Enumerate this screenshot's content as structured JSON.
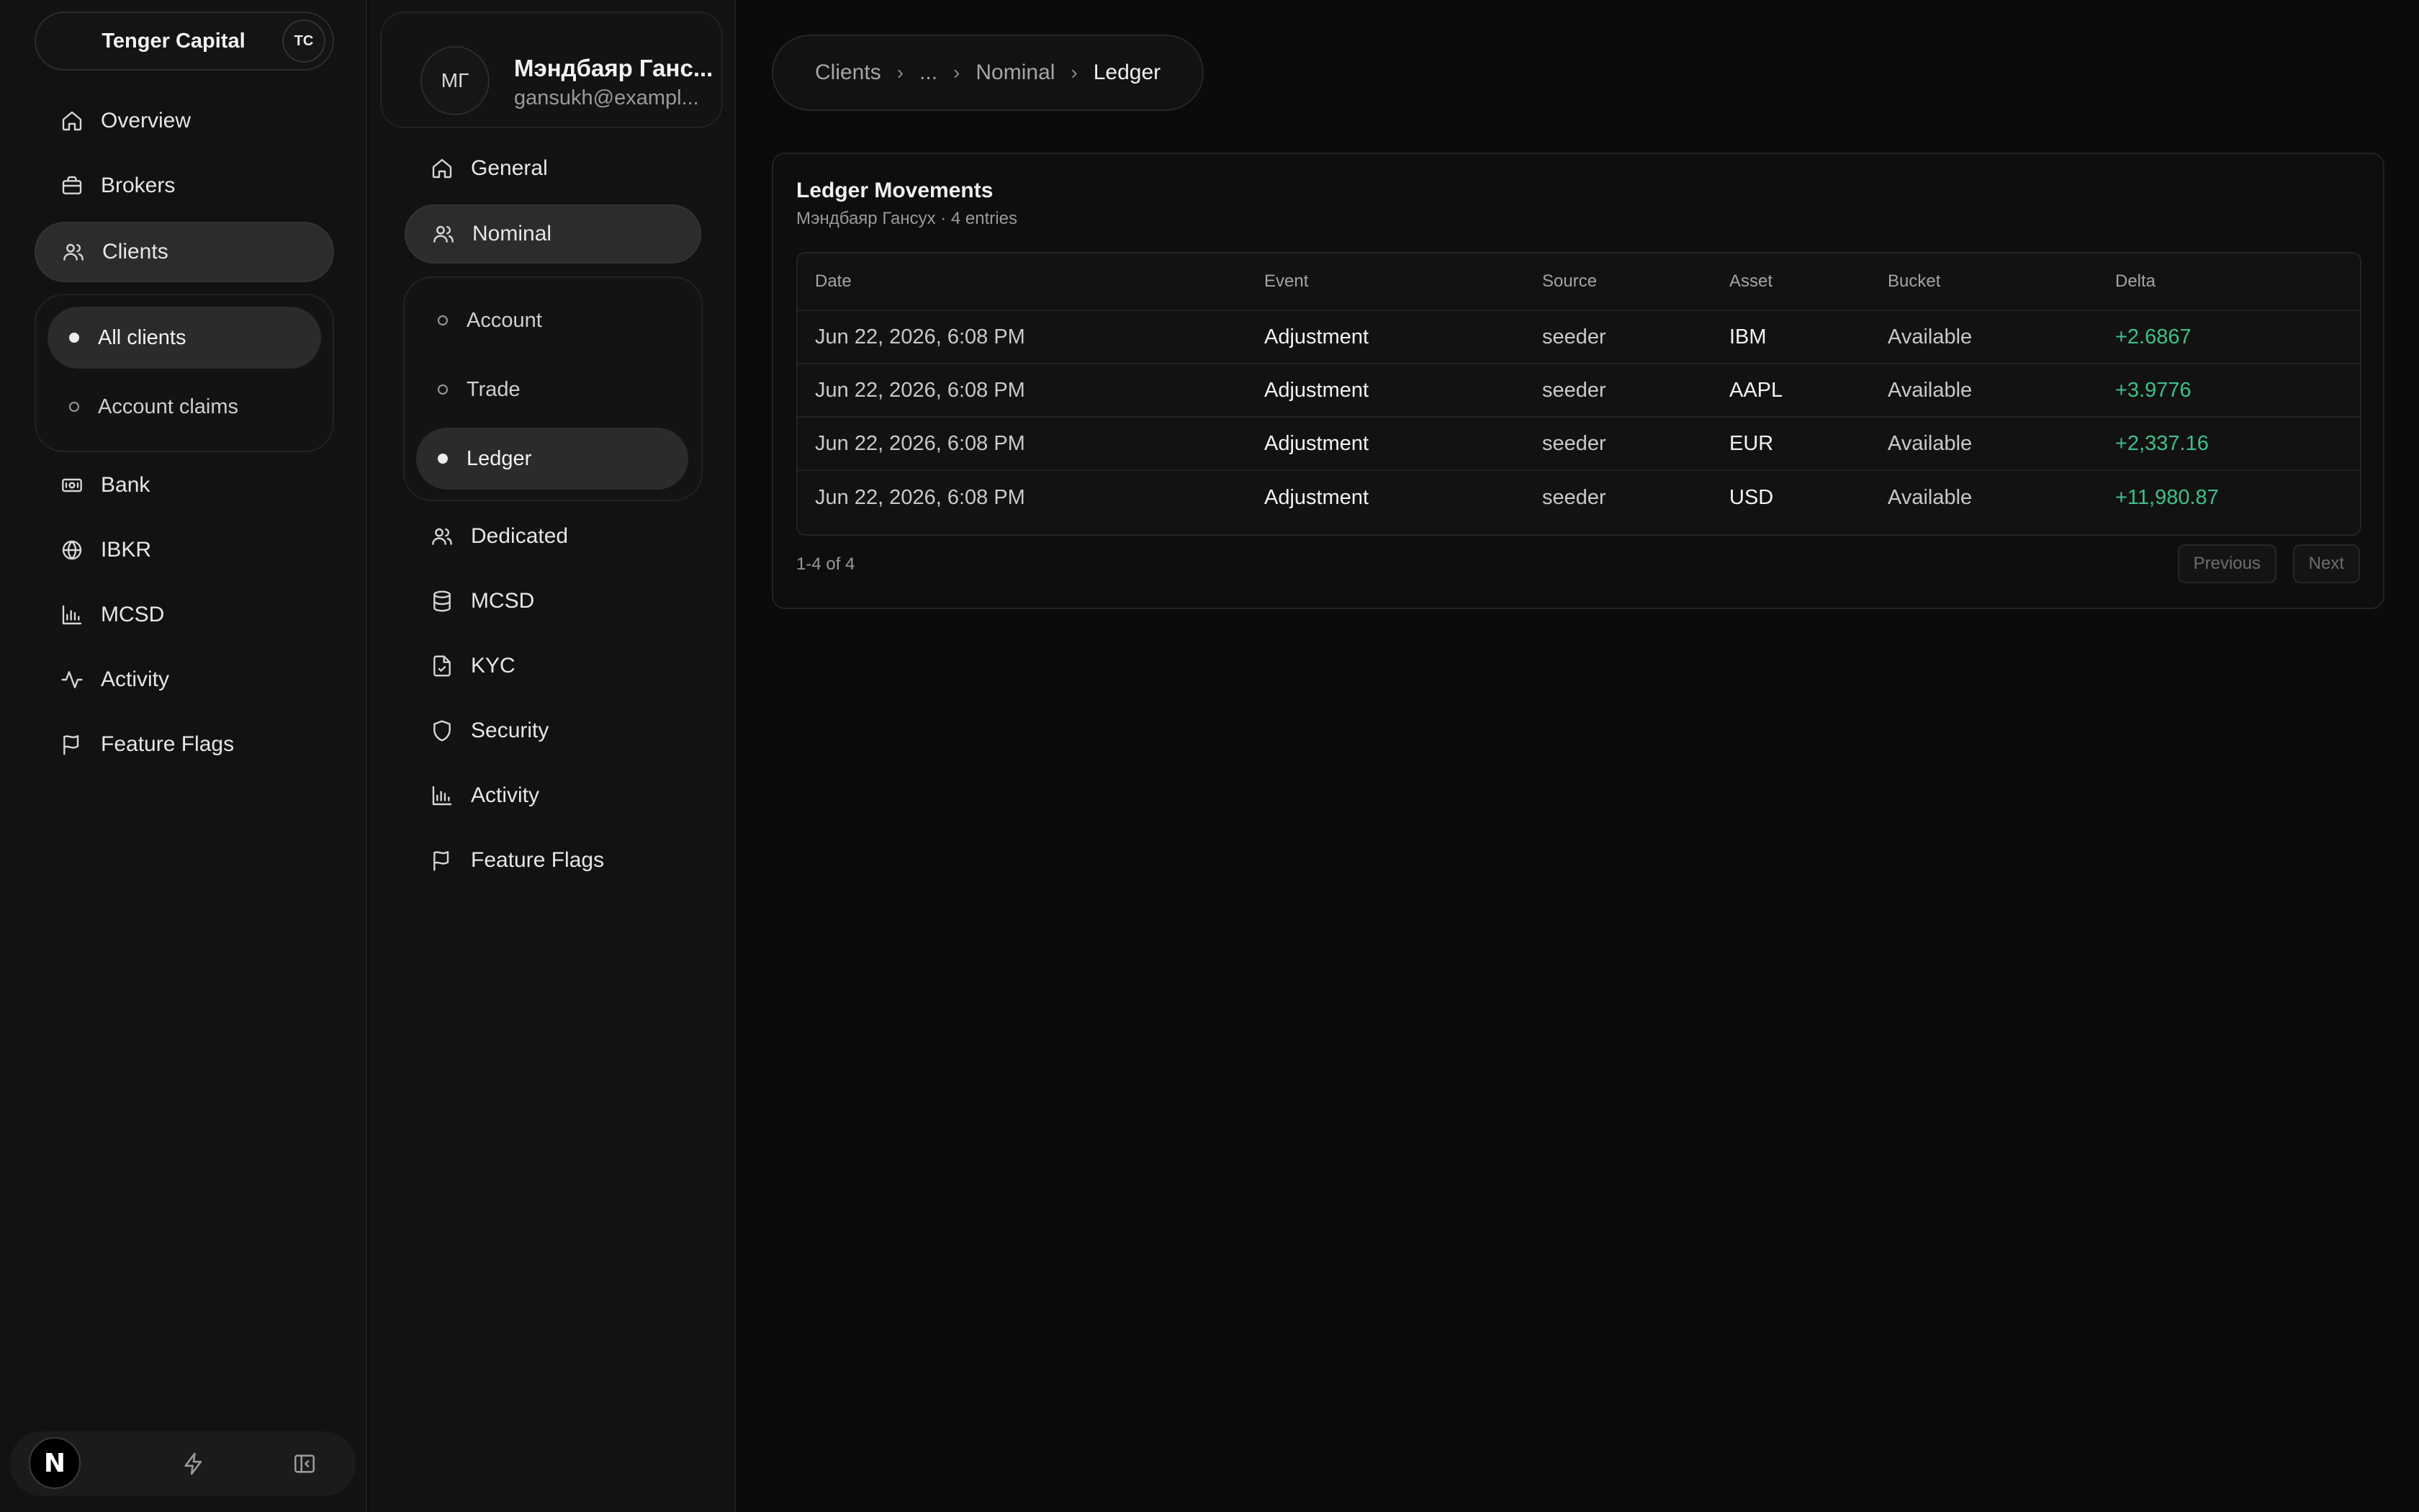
{
  "sidebar": {
    "org_name": "Tenger Capital",
    "org_badge": "TC",
    "items": [
      {
        "label": "Overview",
        "icon": "home-icon"
      },
      {
        "label": "Brokers",
        "icon": "briefcase-icon"
      },
      {
        "label": "Clients",
        "icon": "users-icon",
        "active": true
      },
      {
        "label": "Bank",
        "icon": "banknote-icon"
      },
      {
        "label": "IBKR",
        "icon": "globe-icon"
      },
      {
        "label": "MCSD",
        "icon": "bar-chart-icon"
      },
      {
        "label": "Activity",
        "icon": "activity-icon"
      },
      {
        "label": "Feature Flags",
        "icon": "flag-icon"
      }
    ],
    "clients_sub": [
      {
        "label": "All clients",
        "active": true
      },
      {
        "label": "Account claims"
      }
    ],
    "footer": {
      "logo_letter": "N"
    }
  },
  "client_panel": {
    "avatar_initials": "МГ",
    "name": "Мэндбаяр Ганс...",
    "email": "gansukh@exampl...",
    "items": [
      {
        "label": "General",
        "icon": "home-icon"
      },
      {
        "label": "Nominal",
        "icon": "users-icon",
        "active": true
      },
      {
        "label": "Dedicated",
        "icon": "users-icon"
      },
      {
        "label": "MCSD",
        "icon": "database-icon"
      },
      {
        "label": "KYC",
        "icon": "file-check-icon"
      },
      {
        "label": "Security",
        "icon": "shield-icon"
      },
      {
        "label": "Activity",
        "icon": "bar-chart-icon"
      },
      {
        "label": "Feature Flags",
        "icon": "flag-icon"
      }
    ],
    "nominal_sub": [
      {
        "label": "Account"
      },
      {
        "label": "Trade"
      },
      {
        "label": "Ledger",
        "active": true
      }
    ]
  },
  "breadcrumb": {
    "items": [
      "Clients",
      "...",
      "Nominal",
      "Ledger"
    ]
  },
  "ledger": {
    "title": "Ledger Movements",
    "subtitle": "Мэндбаяр Гансух · 4 entries",
    "columns": [
      "Date",
      "Event",
      "Source",
      "Asset",
      "Bucket",
      "Delta"
    ],
    "rows": [
      {
        "date": "Jun 22, 2026, 6:08 PM",
        "event": "Adjustment",
        "source": "seeder",
        "asset": "IBM",
        "bucket": "Available",
        "delta": "+2.6867"
      },
      {
        "date": "Jun 22, 2026, 6:08 PM",
        "event": "Adjustment",
        "source": "seeder",
        "asset": "AAPL",
        "bucket": "Available",
        "delta": "+3.9776"
      },
      {
        "date": "Jun 22, 2026, 6:08 PM",
        "event": "Adjustment",
        "source": "seeder",
        "asset": "EUR",
        "bucket": "Available",
        "delta": "+2,337.16"
      },
      {
        "date": "Jun 22, 2026, 6:08 PM",
        "event": "Adjustment",
        "source": "seeder",
        "asset": "USD",
        "bucket": "Available",
        "delta": "+11,980.87"
      }
    ],
    "range": "1-4 of 4",
    "prev_label": "Previous",
    "next_label": "Next"
  },
  "colors": {
    "positive_delta": "#3fc08a",
    "background": "#0b0b0b",
    "panel": "#121212"
  }
}
